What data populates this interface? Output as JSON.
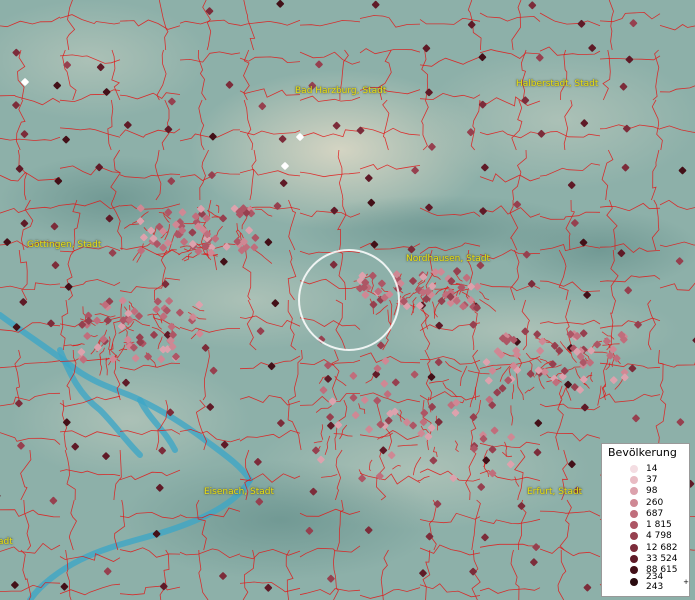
{
  "map": {
    "cities": [
      {
        "name": "Bad Harzburg, Stadt"
      },
      {
        "name": "Halberstadt, Stadt"
      },
      {
        "name": "Göttingen, Stadt"
      },
      {
        "name": "Nordhausen, Stadt"
      },
      {
        "name": "Eisenach, Stadt"
      },
      {
        "name": "Erfurt, Stadt"
      },
      {
        "name": "adt"
      }
    ],
    "boundary_color": "#e01818",
    "river_color": "#3fa6c6"
  },
  "legend": {
    "title": "Bevölkerung",
    "items": [
      {
        "label": "14",
        "color": "#f4dde2"
      },
      {
        "label": "37",
        "color": "#e9bcc4"
      },
      {
        "label": "98",
        "color": "#dca2ad"
      },
      {
        "label": "260",
        "color": "#cf8894"
      },
      {
        "label": "687",
        "color": "#c06e7c"
      },
      {
        "label": "1 815",
        "color": "#ad5665"
      },
      {
        "label": "4 798",
        "color": "#96404f"
      },
      {
        "label": "12 682",
        "color": "#7c2c3a"
      },
      {
        "label": "33 524",
        "color": "#5f1a27"
      },
      {
        "label": "88 615",
        "color": "#431018"
      },
      {
        "label": "234 243",
        "color": "#2a0a0f",
        "suffix": "+"
      }
    ]
  }
}
